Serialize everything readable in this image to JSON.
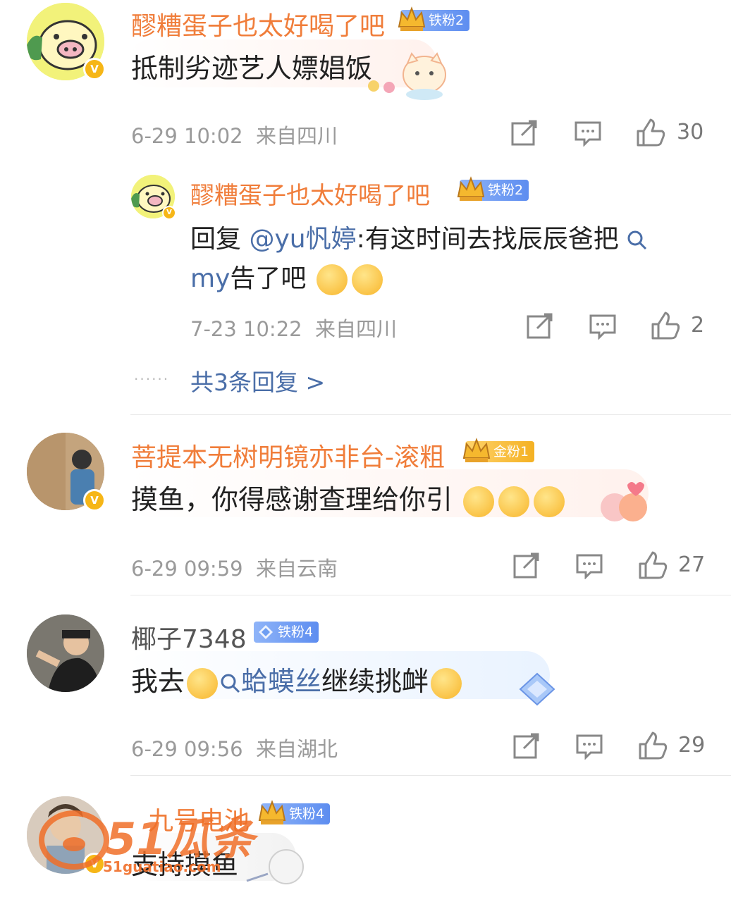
{
  "comments": [
    {
      "username": "醪糟蛋子也太好喝了吧",
      "badge": "铁粉2",
      "text": "抵制劣迹艺人嫖娼饭",
      "time": "6-29 10:02",
      "location": "来自四川",
      "likes": "30"
    },
    {
      "username": "菩提本无树明镜亦非台-滚粗",
      "badge": "金粉1",
      "text": "摸鱼，你得感谢查理给你引",
      "time": "6-29 09:59",
      "location": "来自云南",
      "likes": "27"
    },
    {
      "username": "椰子7348",
      "badge": "铁粉4",
      "text_before": "我去",
      "text_link": "蛤蟆丝",
      "text_after": "继续挑衅",
      "time": "6-29 09:56",
      "location": "来自湖北",
      "likes": "29"
    },
    {
      "username": "九号电池",
      "badge": "铁粉4",
      "text": "支持摸鱼"
    }
  ],
  "reply": {
    "username": "醪糟蛋子也太好喝了吧",
    "badge": "铁粉2",
    "prefix": "回复 ",
    "mention": "@yu忛婷",
    "text": ":有这时间去找辰辰爸把",
    "link": "my",
    "text2": "告了吧",
    "time": "7-23 10:22",
    "location": "来自四川",
    "likes": "2"
  },
  "more_replies": "共3条回复 >",
  "watermark": {
    "logo": "51瓜条",
    "url": "51guatiao.com"
  },
  "colors": {
    "username": "#f07d3a",
    "link": "#4a6ea8",
    "meta": "#9a9a9a"
  }
}
